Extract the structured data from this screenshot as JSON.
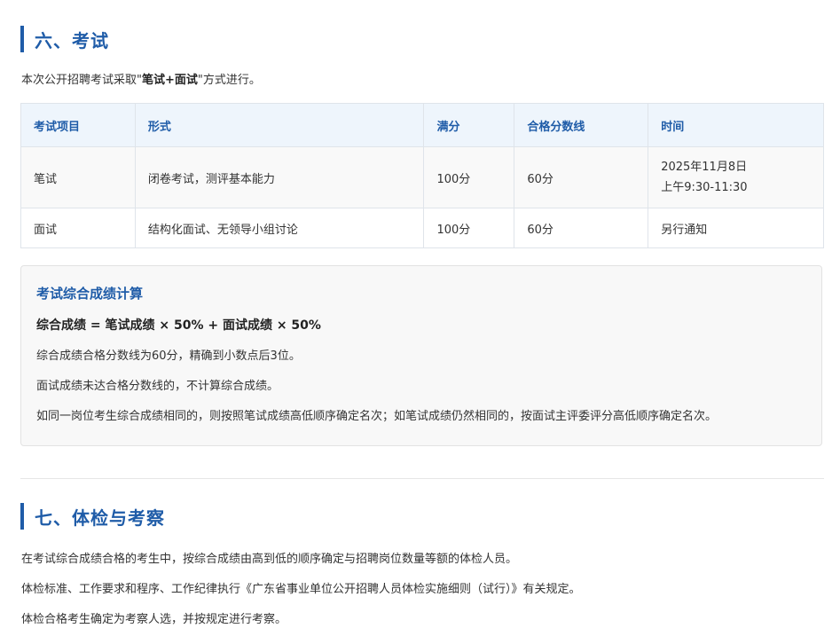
{
  "section6": {
    "title": "六、考试",
    "intro_prefix": "本次公开招聘考试采取\"",
    "intro_bold": "笔试+面试",
    "intro_suffix": "\"方式进行。"
  },
  "exam_table": {
    "headers": [
      "考试项目",
      "形式",
      "满分",
      "合格分数线",
      "时间"
    ],
    "rows": [
      {
        "item": "笔试",
        "form": "闭卷考试，测评基本能力",
        "full_score": "100分",
        "pass_line": "60分",
        "time_line1": "2025年11月8日",
        "time_line2": "上午9:30-11:30"
      },
      {
        "item": "面试",
        "form": "结构化面试、无领导小组讨论",
        "full_score": "100分",
        "pass_line": "60分",
        "time_line1": "另行通知",
        "time_line2": ""
      }
    ]
  },
  "score_box": {
    "title": "考试综合成绩计算",
    "formula": "综合成绩 = 笔试成绩 × 50% + 面试成绩 × 50%",
    "lines": [
      "综合成绩合格分数线为60分，精确到小数点后3位。",
      "面试成绩未达合格分数线的，不计算综合成绩。",
      "如同一岗位考生综合成绩相同的，则按照笔试成绩高低顺序确定名次；如笔试成绩仍然相同的，按面试主评委评分高低顺序确定名次。"
    ]
  },
  "section7": {
    "title": "七、体检与考察",
    "paragraphs": [
      "在考试综合成绩合格的考生中，按综合成绩由高到低的顺序确定与招聘岗位数量等额的体检人员。",
      "体检标准、工作要求和程序、工作纪律执行《广东省事业单位公开招聘人员体检实施细则（试行）》有关规定。",
      "体检合格考生确定为考察人选，并按规定进行考察。"
    ]
  },
  "colors": {
    "accent": "#1f5ca8",
    "table_header_bg": "#eef5fc",
    "box_bg": "#f8f8f8"
  }
}
